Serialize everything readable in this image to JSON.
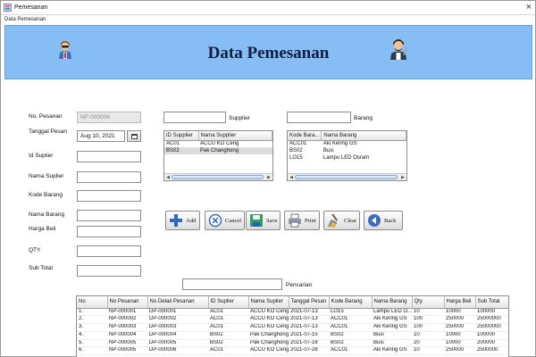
{
  "window": {
    "title": "Pemesanan",
    "close_glyph": "×"
  },
  "frame_label": "Data Pemesanan",
  "header": {
    "title": "Data Pemesanan"
  },
  "form": {
    "no_pesanan": {
      "label": "No. Pesanan",
      "value": "NP-000006"
    },
    "tanggal_pesan": {
      "label": "Tanggal Pesan",
      "value": "Aug 10, 2021"
    },
    "id_supplier": {
      "label": "Id Suplier",
      "value": ""
    },
    "nama_supplier": {
      "label": "Nama Suplier",
      "value": ""
    },
    "kode_barang": {
      "label": "Kode Barang",
      "value": ""
    },
    "nama_barang": {
      "label": "Nama Barang",
      "value": ""
    },
    "harga_beli": {
      "label": "Harga Beli",
      "value": ""
    },
    "qty": {
      "label": "QTY",
      "value": ""
    },
    "sub_total": {
      "label": "Sub Total",
      "value": ""
    }
  },
  "supplier_search": {
    "label": "Supplier",
    "value": ""
  },
  "barang_search": {
    "label": "Barang",
    "value": ""
  },
  "supplier_table": {
    "columns": [
      "ID Supplier",
      "Nama Supplier"
    ],
    "rows": [
      [
        "AC01",
        "ACCU KO Ceng"
      ],
      [
        "BS02",
        "Pak Changhong"
      ]
    ]
  },
  "barang_table": {
    "columns": [
      "Kode Bara...",
      "Nama Barang"
    ],
    "rows": [
      [
        "ACC01",
        "Aki Kering GS"
      ],
      [
        "BS02",
        "Busi"
      ],
      [
        "LO15",
        "Lampu LED Osram"
      ]
    ]
  },
  "buttons": {
    "add": "Add",
    "cancel": "Cancel",
    "save": "Save",
    "print": "Print",
    "clear": "Clear",
    "back": "Back"
  },
  "pencarian": {
    "label": "Pencarian",
    "value": ""
  },
  "main_table": {
    "columns": [
      "No",
      "No Pesanan",
      "No Detail Pesanan",
      "ID Suplier",
      "Nama Suplier",
      "Tanggal Pesan",
      "Kode Barang",
      "Nama Barang",
      "Qty",
      "Harga Beli",
      "Sub Total"
    ],
    "rows": [
      [
        "1.",
        "NP-000001",
        "DP-000001",
        "AC01",
        "ACCU KO Ceng",
        "2021-07-13",
        "LO15",
        "Lampu LED O...",
        "10",
        "10000",
        "100000"
      ],
      [
        "2.",
        "NP-000002",
        "DP-000002",
        "AC01",
        "ACCU KO Ceng",
        "2021-07-13",
        "ACC01",
        "Aki Kering GS",
        "100",
        "250000",
        "25000000"
      ],
      [
        "3.",
        "NP-000003",
        "DP-000003",
        "AC01",
        "ACCU KO Ceng",
        "2021-07-13",
        "ACC01",
        "Aki Kering GS",
        "100",
        "250000",
        "25000000"
      ],
      [
        "4.",
        "NP-000004",
        "DP-000004",
        "BS02",
        "Pak Changhong",
        "2021-07-15",
        "BS02",
        "Busi",
        "10",
        "10000",
        "100000"
      ],
      [
        "5.",
        "NP-000005",
        "DP-000005",
        "BS02",
        "Pak Changhong",
        "2021-07-16",
        "BS02",
        "Busi",
        "20",
        "10000",
        "200000"
      ],
      [
        "6.",
        "NP-000005",
        "DP-000006",
        "AC01",
        "ACCU KO Ceng",
        "2021-07-28",
        "ACC01",
        "Aki Kering GS",
        "10",
        "250000",
        "2500000"
      ]
    ]
  },
  "colors": {
    "header_bg": "#86bdf5",
    "header_border": "#5f9fe3",
    "title_text": "#0f1f3d"
  },
  "icons": {
    "app": "app-icon",
    "avatar_left": "user-avatar-icon",
    "avatar_right": "mechanic-avatar-icon",
    "add": "plus-icon",
    "cancel": "x-circle-icon",
    "save": "floppy-disk-icon",
    "print": "printer-icon",
    "clear": "broom-icon",
    "back": "back-arrow-icon",
    "calendar": "calendar-icon"
  }
}
